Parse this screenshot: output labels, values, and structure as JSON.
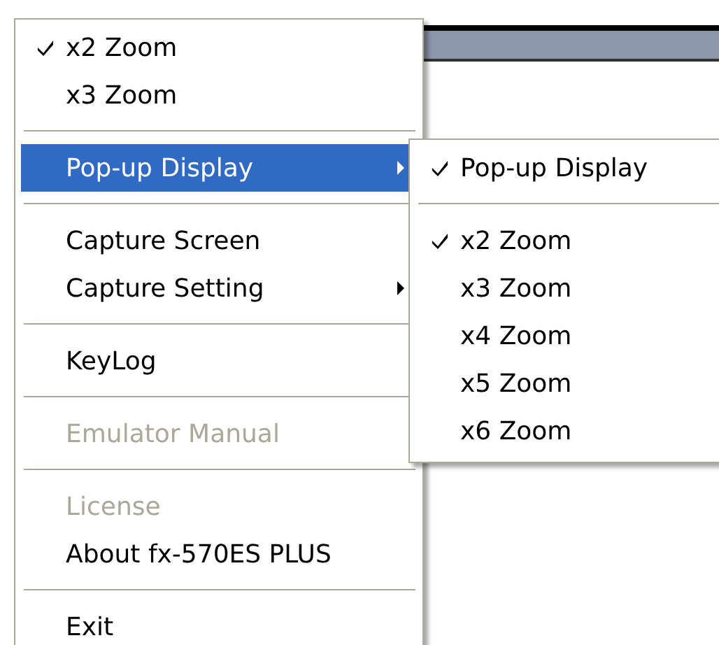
{
  "menu": {
    "items": [
      {
        "kind": "item",
        "label": "x2 Zoom",
        "checked": true,
        "selected": false,
        "disabled": false,
        "has_submenu": false
      },
      {
        "kind": "item",
        "label": "x3 Zoom",
        "checked": false,
        "selected": false,
        "disabled": false,
        "has_submenu": false
      },
      {
        "kind": "separator"
      },
      {
        "kind": "item",
        "label": "Pop-up Display",
        "checked": false,
        "selected": true,
        "disabled": false,
        "has_submenu": true
      },
      {
        "kind": "separator"
      },
      {
        "kind": "item",
        "label": "Capture Screen",
        "checked": false,
        "selected": false,
        "disabled": false,
        "has_submenu": false
      },
      {
        "kind": "item",
        "label": "Capture Setting",
        "checked": false,
        "selected": false,
        "disabled": false,
        "has_submenu": true
      },
      {
        "kind": "separator"
      },
      {
        "kind": "item",
        "label": "KeyLog",
        "checked": false,
        "selected": false,
        "disabled": false,
        "has_submenu": false
      },
      {
        "kind": "separator"
      },
      {
        "kind": "item",
        "label": "Emulator Manual",
        "checked": false,
        "selected": false,
        "disabled": true,
        "has_submenu": false
      },
      {
        "kind": "separator"
      },
      {
        "kind": "item",
        "label": "License",
        "checked": false,
        "selected": false,
        "disabled": true,
        "has_submenu": false
      },
      {
        "kind": "item",
        "label": "About fx-570ES PLUS",
        "checked": false,
        "selected": false,
        "disabled": false,
        "has_submenu": false
      },
      {
        "kind": "separator"
      },
      {
        "kind": "item",
        "label": "Exit",
        "checked": false,
        "selected": false,
        "disabled": false,
        "has_submenu": false
      }
    ]
  },
  "submenu": {
    "items": [
      {
        "kind": "item",
        "label": "Pop-up Display",
        "checked": true,
        "selected": false,
        "disabled": false,
        "has_submenu": false
      },
      {
        "kind": "separator"
      },
      {
        "kind": "item",
        "label": "x2 Zoom",
        "checked": true,
        "selected": false,
        "disabled": false,
        "has_submenu": false
      },
      {
        "kind": "item",
        "label": "x3 Zoom",
        "checked": false,
        "selected": false,
        "disabled": false,
        "has_submenu": false
      },
      {
        "kind": "item",
        "label": "x4 Zoom",
        "checked": false,
        "selected": false,
        "disabled": false,
        "has_submenu": false
      },
      {
        "kind": "item",
        "label": "x5 Zoom",
        "checked": false,
        "selected": false,
        "disabled": false,
        "has_submenu": false
      },
      {
        "kind": "item",
        "label": "x6 Zoom",
        "checked": false,
        "selected": false,
        "disabled": false,
        "has_submenu": false
      }
    ]
  }
}
